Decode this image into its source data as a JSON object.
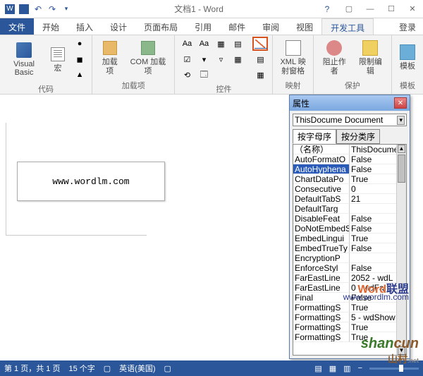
{
  "title": "文档1 - Word",
  "tabs": [
    "文件",
    "开始",
    "插入",
    "设计",
    "页面布局",
    "引用",
    "邮件",
    "审阅",
    "视图",
    "开发工具"
  ],
  "login": "登录",
  "ribbon": {
    "code": {
      "label": "代码",
      "vb": "Visual Basic",
      "macros": "宏"
    },
    "addins": {
      "label": "加载项",
      "addins": "加载项",
      "com": "COM 加载项"
    },
    "controls": {
      "label": "控件",
      "aa1": "Aa",
      "aa2": "Aa"
    },
    "mapping": {
      "label": "映射",
      "xml": "XML 映\n射窗格"
    },
    "protect": {
      "label": "保护",
      "block": "阻止作者",
      "restrict": "限制编辑"
    },
    "templates": {
      "label": "模板",
      "template": "模板"
    }
  },
  "doc": {
    "textbox": "www.wordlm.com"
  },
  "props": {
    "title": "属性",
    "object": "ThisDocume Document",
    "tab_alpha": "按字母序",
    "tab_cat": "按分类序",
    "rows": [
      {
        "k": "（名称）",
        "v": "ThisDocume"
      },
      {
        "k": "AutoFormatO",
        "v": "False"
      },
      {
        "k": "AutoHyphena",
        "v": "False",
        "sel": true
      },
      {
        "k": "ChartDataPo",
        "v": "True"
      },
      {
        "k": "Consecutive",
        "v": "0"
      },
      {
        "k": "DefaultTabS",
        "v": "21"
      },
      {
        "k": "DefaultTarg",
        "v": ""
      },
      {
        "k": "DisableFeat",
        "v": "False"
      },
      {
        "k": "DoNotEmbedS",
        "v": "False"
      },
      {
        "k": "EmbedLingui",
        "v": "True"
      },
      {
        "k": "EmbedTrueTy",
        "v": "False"
      },
      {
        "k": "EncryptionP",
        "v": ""
      },
      {
        "k": "EnforceStyl",
        "v": "False"
      },
      {
        "k": "FarEastLine",
        "v": "2052 - wdL"
      },
      {
        "k": "FarEastLine",
        "v": "0 - wdFarE"
      },
      {
        "k": "Final",
        "v": "False"
      },
      {
        "k": "FormattingS",
        "v": "True"
      },
      {
        "k": "FormattingS",
        "v": "5 - wdShow"
      },
      {
        "k": "FormattingS",
        "v": "True"
      },
      {
        "k": "FormattingS",
        "v": "True"
      }
    ]
  },
  "status": {
    "page": "第 1 页，共 1 页",
    "words": "15 个字",
    "lang": "英语(美国)"
  },
  "watermarks": {
    "w1a": "Word",
    "w1b": "联盟",
    "w2": "www.wordlm.com",
    "w3a": "shan",
    "w3b": "cun",
    "w3c": "山村"
  }
}
